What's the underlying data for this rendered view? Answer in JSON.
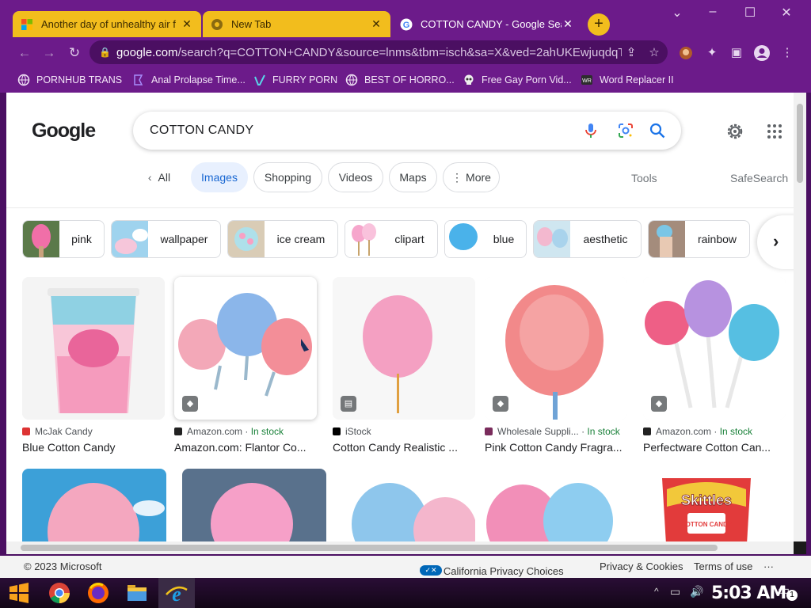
{
  "browser": {
    "tabs": [
      {
        "title": "Another day of unhealthy air f",
        "favicon": "microsoft-icon",
        "active": false
      },
      {
        "title": "New Tab",
        "favicon": "chrome-icon",
        "active": false
      },
      {
        "title": "COTTON CANDY - Google Sear",
        "favicon": "google-icon",
        "active": true
      }
    ],
    "url_host": "google.com",
    "url_path": "/search?q=COTTON+CANDY&source=lnms&tbm=isch&sa=X&ved=2ahUKEwjuqdqTkr...",
    "bookmarks": [
      {
        "label": "PORNHUB TRANS",
        "icon": "globe-icon"
      },
      {
        "label": "Anal Prolapse Time...",
        "icon": "bookmark-icon"
      },
      {
        "label": "FURRY PORN",
        "icon": "vimeo-icon"
      },
      {
        "label": "BEST OF HORRO...",
        "icon": "globe-icon"
      },
      {
        "label": "Free Gay Porn Vid...",
        "icon": "skull-icon"
      },
      {
        "label": "Word Replacer II",
        "icon": "extension-icon"
      }
    ]
  },
  "search": {
    "query": "COTTON CANDY",
    "logo_text": "Google",
    "filters": [
      "All",
      "Images",
      "Shopping",
      "Videos",
      "Maps",
      "More"
    ],
    "selected_filter": "Images",
    "tools_label": "Tools",
    "safesearch_label": "SafeSearch"
  },
  "refinements": [
    "pink",
    "wallpaper",
    "ice cream",
    "clipart",
    "blue",
    "aesthetic",
    "rainbow"
  ],
  "results": [
    {
      "source": "McJak Candy",
      "in_stock": "",
      "title": "Blue Cotton Candy"
    },
    {
      "source": "Amazon.com",
      "in_stock": "In stock",
      "title": "Amazon.com: Flantor Co..."
    },
    {
      "source": "iStock",
      "in_stock": "",
      "title": "Cotton Candy Realistic ..."
    },
    {
      "source": "Wholesale Suppli...",
      "in_stock": "In stock",
      "title": "Pink Cotton Candy Fragra..."
    },
    {
      "source": "Amazon.com",
      "in_stock": "In stock",
      "title": "Perfectware Cotton Can..."
    }
  ],
  "second_row_text": [
    "Skittles",
    "COTTON CANDY"
  ],
  "footer": {
    "copyright": "© 2023 Microsoft",
    "privacy_choices": "Your California Privacy Choices",
    "privacy_cookies": "Privacy & Cookies",
    "terms": "Terms of use",
    "more": "···"
  },
  "taskbar": {
    "clock": "5:03 AM",
    "notification_count": "1"
  },
  "colors": {
    "browser_frame": "#6c1b8a",
    "inactive_tab": "#f2bd1d",
    "google_blue": "#1a73e8"
  }
}
